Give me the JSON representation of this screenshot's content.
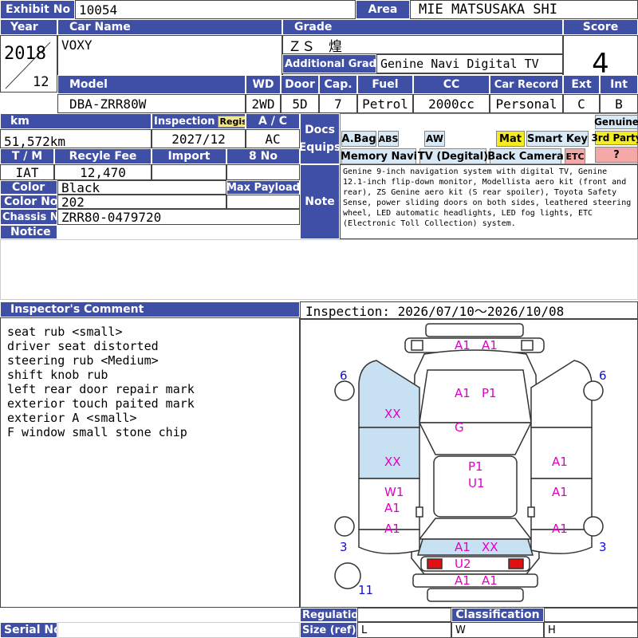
{
  "header": {
    "exhibit_label": "Exhibit No",
    "exhibit_no": "10054",
    "area_label": "Area",
    "area": "MIE MATSUSAKA SHI"
  },
  "row1": {
    "year_label": "Year",
    "car_name_label": "Car Name",
    "grade_label": "Grade",
    "score_label": "Score",
    "year": "2018",
    "month": "12",
    "car_name": "VOXY",
    "grade": "ＺＳ　煌",
    "additional_grade_label": "Additional Grade",
    "additional_grade": "Genine Navi Digital TV",
    "score": "4"
  },
  "row2": {
    "model_label": "Model",
    "wd_label": "WD",
    "door_label": "Door",
    "cap_label": "Cap.",
    "fuel_label": "Fuel",
    "cc_label": "CC",
    "car_record_label": "Car Record",
    "ext_label": "Ext",
    "int_label": "Int",
    "model": "DBA-ZRR80W",
    "wd": "2WD",
    "door": "5D",
    "cap": "7",
    "fuel": "Petrol",
    "cc": "2000cc",
    "car_record": "Personal",
    "ext": "C",
    "int": "B"
  },
  "specs": {
    "km_label": "km",
    "inspection_label": "Inspection",
    "regist_label": "Regist",
    "ac_label": "A / C",
    "km": "51,572km",
    "inspection": "2027/12",
    "ac": "AC",
    "tm_label": "T / M",
    "recycle_label": "Recyle Fee",
    "import_label": "Import",
    "eight_no_label": "8 No",
    "tm": "IAT",
    "recycle": "12,470",
    "import": "",
    "eight_no": "",
    "color_label": "Color",
    "color": "Black",
    "max_payload_label": "Max Payload",
    "color_no_label": "Color No",
    "color_no": "202",
    "chassis_label": "Chassis No",
    "chassis": "ZRR80-0479720",
    "notice_label": "Notice"
  },
  "equips": {
    "label_docs": "Docs",
    "label_equips": "Equips",
    "abag": "A.Bag",
    "abs": "ABS",
    "aw": "AW",
    "mat": "Mat",
    "smart_key": "Smart Key",
    "genuine": "Genuine",
    "third_party": "3rd Party",
    "question": "?",
    "memory_navi": "Memory Navi",
    "tv_digital": "TV (Degital)",
    "back_camera": "Back Camera",
    "etc": "ETC"
  },
  "note": {
    "label": "Note",
    "text": "Genine 9-inch navigation system with digital TV, Genine 12.1-inch flip-down monitor, Modellista aero kit (front and rear), ZS Genine aero kit (S rear spoiler), Toyota Safety Sense, power sliding doors on both sides, leathered steering wheel, LED automatic headlights, LED fog lights, ETC (Electronic Toll Collection) system."
  },
  "inspector": {
    "label": "Inspector's Comment",
    "period": "Inspection: 2026/07/10～2026/10/08",
    "lines": [
      "seat rub <small>",
      "driver seat distorted",
      "steering rub <Medium>",
      "shift knob rub",
      "left rear door repair mark",
      "exterior touch paited mark",
      "exterior A <small>",
      "F window small stone chip"
    ]
  },
  "diagram": {
    "marks": {
      "rear_top_a": "A1",
      "rear_top_b": "A1",
      "hood_a": "A1",
      "hood_p": "P1",
      "windshield": "G",
      "roof_p": "P1",
      "roof_u": "U1",
      "left_front_xx": "XX",
      "left_mid_xx": "XX",
      "left_w1": "W1",
      "left_a1a": "A1",
      "left_a1b": "A1",
      "right_a1a": "A1",
      "right_a1b": "A1",
      "right_a1c": "A1",
      "front_a1": "A1",
      "front_xx": "XX",
      "front_u2": "U2",
      "bottom_a1a": "A1",
      "bottom_a1b": "A1"
    },
    "nums": {
      "tl": "6",
      "tr": "6",
      "bl": "3",
      "br": "3",
      "spare": "11"
    },
    "colors": {
      "damage_fill": "#c7e0f2",
      "light": "#e8e000",
      "brake": "#e01010"
    }
  },
  "footer": {
    "serial_label": "Serial No",
    "regulation_label": "Regulation",
    "size_label": "Size (ref)",
    "classification_label": "Classification",
    "l": "L",
    "w": "W",
    "h": "H"
  }
}
